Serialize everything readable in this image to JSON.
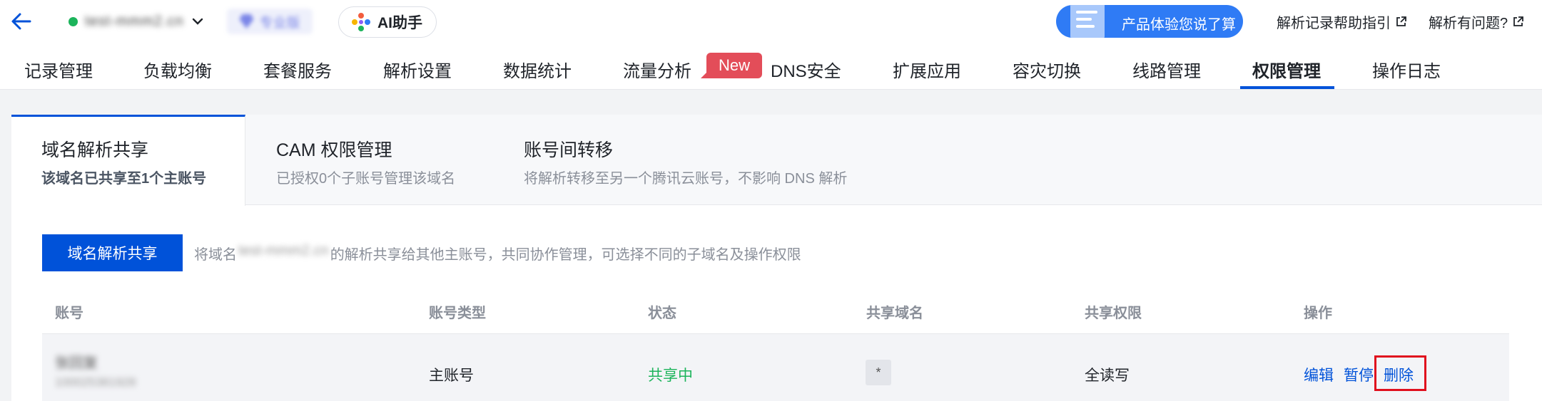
{
  "topbar": {
    "back_icon": "arrow-left-icon",
    "domain": "test-mmm2.cn",
    "plan": "专业版",
    "ai_button": "AI助手",
    "survey_button": "产品体验您说了算",
    "help_links": [
      "解析记录帮助指引",
      "解析有问题?"
    ]
  },
  "nav": {
    "tabs": [
      "记录管理",
      "负载均衡",
      "套餐服务",
      "解析设置",
      "数据统计",
      "流量分析",
      "DNS安全",
      "扩展应用",
      "容灾切换",
      "线路管理",
      "权限管理",
      "操作日志"
    ],
    "active": "权限管理",
    "new_badge": "New"
  },
  "subtabs": [
    {
      "title": "域名解析共享",
      "desc": "该域名已共享至1个主账号"
    },
    {
      "title": "CAM 权限管理",
      "desc": "已授权0个子账号管理该域名"
    },
    {
      "title": "账号间转移",
      "desc": "将解析转移至另一个腾讯云账号，不影响 DNS 解析"
    }
  ],
  "share": {
    "button": "域名解析共享",
    "desc_prefix": "将域名",
    "desc_domain": "test-mmm2.cn",
    "desc_suffix": "的解析共享给其他主账号，共同协作管理，可选择不同的子域名及操作权限"
  },
  "table": {
    "headers": [
      "账号",
      "账号类型",
      "状态",
      "共享域名",
      "共享权限",
      "操作"
    ],
    "rows": [
      {
        "account_name": "张回复",
        "account_id": "100025381928",
        "type": "主账号",
        "status": "共享中",
        "domain": "*",
        "permission": "全读写",
        "actions": [
          "编辑",
          "暂停",
          "删除"
        ]
      }
    ]
  },
  "colors": {
    "primary": "#0052d9",
    "success": "#1cb45b",
    "danger": "#e0101e",
    "new_badge": "#e34d59"
  }
}
